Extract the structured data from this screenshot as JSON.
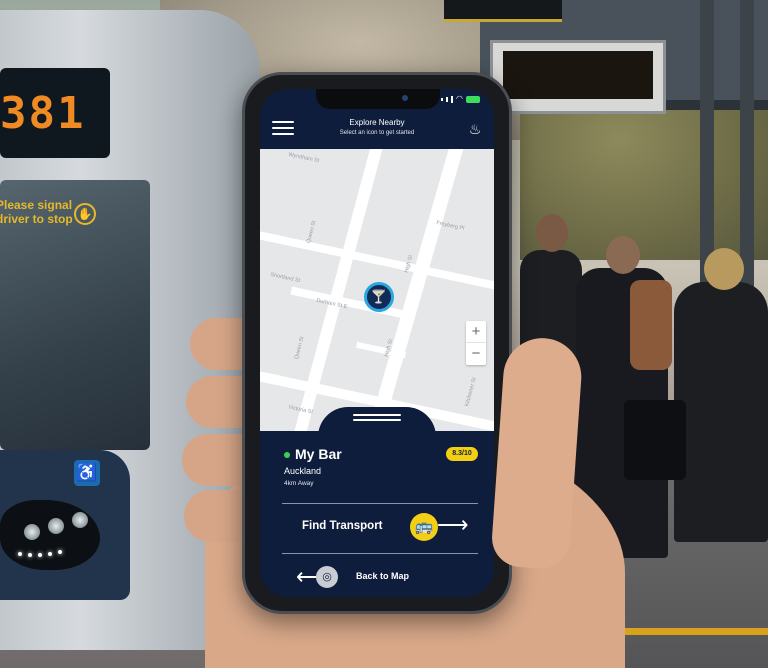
{
  "bus": {
    "route_number": "381",
    "signal_text": "Please signal driver to stop",
    "signal_icon": "hand-icon",
    "accessibility_icon": "wheelchair-icon"
  },
  "app": {
    "header": {
      "title": "Explore Nearby",
      "subtitle": "Select an icon to get started",
      "menu_icon": "menu-icon",
      "action_icon": "flame-icon"
    },
    "map": {
      "streets": [
        "Wyndham St",
        "Queen St",
        "Freyberg Pl",
        "Shortland St",
        "Durham St E",
        "High St",
        "Victoria St",
        "Kitchener St"
      ],
      "pin_icon": "cocktail-icon",
      "zoom_in_label": "+",
      "zoom_out_label": "−"
    },
    "venue": {
      "name": "My Bar",
      "city": "Auckland",
      "distance": "4km Away",
      "rating": "8.3/10",
      "status_color": "#39d15c"
    },
    "actions": {
      "find_transport_label": "Find Transport",
      "find_transport_icon": "bus-icon",
      "back_to_map_label": "Back to Map",
      "back_to_map_icon": "map-icon"
    }
  },
  "colors": {
    "app_navy": "#0f1d3d",
    "accent_yellow": "#f2cf15",
    "pin_ring": "#2aa7df"
  }
}
